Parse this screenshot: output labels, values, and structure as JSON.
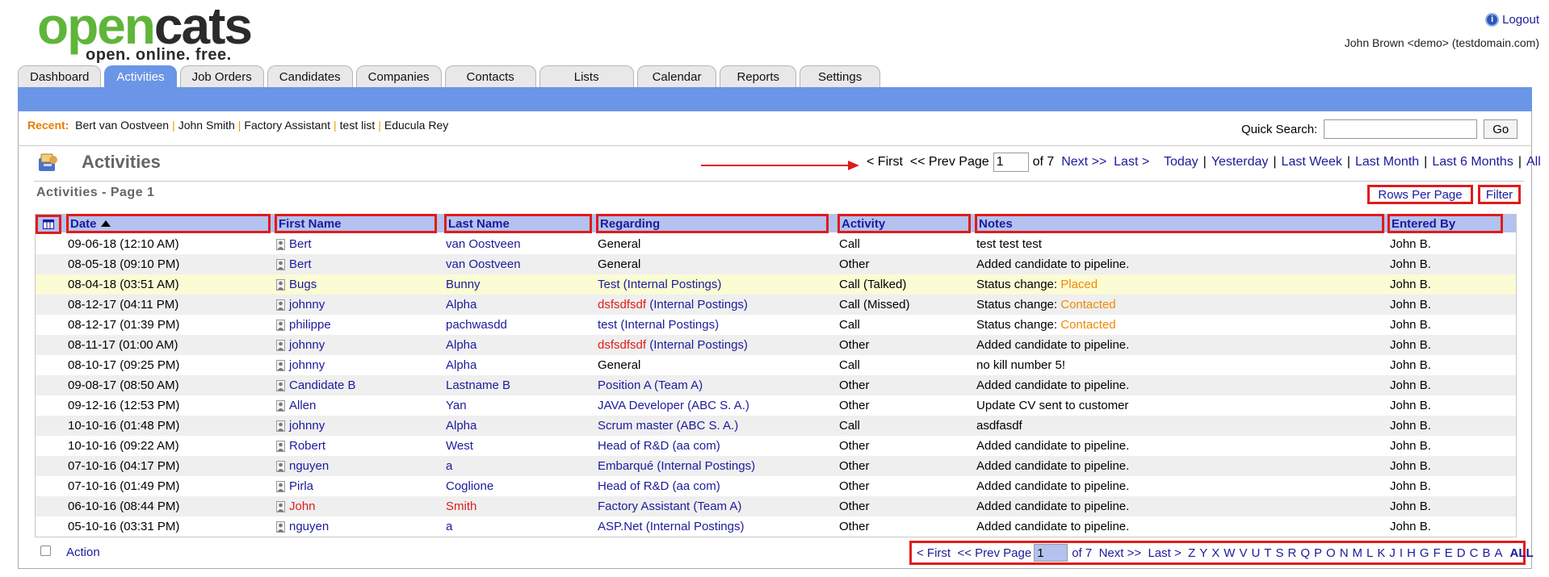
{
  "brand": {
    "word_green": "open",
    "word_dark": "cats",
    "tagline": "open. online. free."
  },
  "header": {
    "logout_label": "Logout",
    "user_line": "John Brown <demo> (testdomain.com)"
  },
  "tabs": [
    {
      "label": "Dashboard",
      "active": false
    },
    {
      "label": "Activities",
      "active": true
    },
    {
      "label": "Job Orders",
      "active": false
    },
    {
      "label": "Candidates",
      "active": false
    },
    {
      "label": "Companies",
      "active": false
    },
    {
      "label": "Contacts",
      "active": false
    },
    {
      "label": "Lists",
      "active": false
    },
    {
      "label": "Calendar",
      "active": false
    },
    {
      "label": "Reports",
      "active": false
    },
    {
      "label": "Settings",
      "active": false
    }
  ],
  "recent": {
    "label": "Recent:",
    "items": [
      "Bert van Oostveen",
      "John Smith",
      "Factory Assistant",
      "test list",
      "Educula Rey"
    ]
  },
  "quick_search": {
    "label": "Quick Search:",
    "value": "",
    "go_label": "Go"
  },
  "page": {
    "title": "Activities",
    "subtitle": "Activities - Page 1"
  },
  "top_pager": {
    "first": "< First",
    "prev": "<< Prev",
    "page_label": "Page",
    "page_value": "1",
    "of": "of 7",
    "next": "Next >>",
    "last": "Last >",
    "periods": [
      "Today",
      "Yesterday",
      "Last Week",
      "Last Month",
      "Last 6 Months",
      "All"
    ]
  },
  "controls": {
    "rows_per_page": "Rows Per Page",
    "filter": "Filter"
  },
  "columns": {
    "date": "Date",
    "first": "First Name",
    "last": "Last Name",
    "regarding": "Regarding",
    "activity": "Activity",
    "notes": "Notes",
    "by": "Entered By"
  },
  "rows": [
    {
      "date": "09-06-18 (12:10 AM)",
      "first": "Bert",
      "last": "van Oostveen",
      "reg_link": "",
      "reg_plain": "General",
      "reg_red": "",
      "activity": "Call",
      "notes": "test test test",
      "status": "",
      "by": "John B."
    },
    {
      "date": "08-05-18 (09:10 PM)",
      "first": "Bert",
      "last": "van Oostveen",
      "reg_link": "",
      "reg_plain": "General",
      "reg_red": "",
      "activity": "Other",
      "notes": "Added candidate to pipeline.",
      "status": "",
      "by": "John B."
    },
    {
      "date": "08-04-18 (03:51 AM)",
      "first": "Bugs",
      "last": "Bunny",
      "reg_link": "Test (Internal Postings)",
      "reg_plain": "",
      "reg_red": "",
      "activity": "Call (Talked)",
      "notes": "Status change: ",
      "status": "Placed",
      "by": "John B."
    },
    {
      "date": "08-12-17 (04:11 PM)",
      "first": "johnny",
      "last": "Alpha",
      "reg_link": " (Internal Postings)",
      "reg_plain": "",
      "reg_red": "dsfsdfsdf",
      "activity": "Call (Missed)",
      "notes": "Status change: ",
      "status": "Contacted",
      "by": "John B."
    },
    {
      "date": "08-12-17 (01:39 PM)",
      "first": "philippe",
      "last": "pachwasdd",
      "reg_link": "test (Internal Postings)",
      "reg_plain": "",
      "reg_red": "",
      "activity": "Call",
      "notes": "Status change: ",
      "status": "Contacted",
      "by": "John B."
    },
    {
      "date": "08-11-17 (01:00 AM)",
      "first": "johnny",
      "last": "Alpha",
      "reg_link": " (Internal Postings)",
      "reg_plain": "",
      "reg_red": "dsfsdfsdf",
      "activity": "Other",
      "notes": "Added candidate to pipeline.",
      "status": "",
      "by": "John B."
    },
    {
      "date": "08-10-17 (09:25 PM)",
      "first": "johnny",
      "last": "Alpha",
      "reg_link": "",
      "reg_plain": "General",
      "reg_red": "",
      "activity": "Call",
      "notes": "no kill number 5!",
      "status": "",
      "by": "John B."
    },
    {
      "date": "09-08-17 (08:50 AM)",
      "first": "Candidate B",
      "last": "Lastname B",
      "reg_link": "Position A (Team A)",
      "reg_plain": "",
      "reg_red": "",
      "activity": "Other",
      "notes": "Added candidate to pipeline.",
      "status": "",
      "by": "John B."
    },
    {
      "date": "09-12-16 (12:53 PM)",
      "first": "Allen",
      "last": "Yan",
      "reg_link": "JAVA Developer (ABC S. A.)",
      "reg_plain": "",
      "reg_red": "",
      "activity": "Other",
      "notes": "Update CV sent to customer",
      "status": "",
      "by": "John B."
    },
    {
      "date": "10-10-16 (01:48 PM)",
      "first": "johnny",
      "last": "Alpha",
      "reg_link": "Scrum master (ABC S. A.)",
      "reg_plain": "",
      "reg_red": "",
      "activity": "Call",
      "notes": "asdfasdf",
      "status": "",
      "by": "John B."
    },
    {
      "date": "10-10-16 (09:22 AM)",
      "first": "Robert",
      "last": "West",
      "reg_link": "Head of R&D (aa com)",
      "reg_plain": "",
      "reg_red": "",
      "activity": "Other",
      "notes": "Added candidate to pipeline.",
      "status": "",
      "by": "John B."
    },
    {
      "date": "07-10-16 (04:17 PM)",
      "first": "nguyen",
      "last": "a",
      "reg_link": "Embarqué (Internal Postings)",
      "reg_plain": "",
      "reg_red": "",
      "activity": "Other",
      "notes": "Added candidate to pipeline.",
      "status": "",
      "by": "John B."
    },
    {
      "date": "07-10-16 (01:49 PM)",
      "first": "Pirla",
      "last": "Coglione",
      "reg_link": "Head of R&D (aa com)",
      "reg_plain": "",
      "reg_red": "",
      "activity": "Other",
      "notes": "Added candidate to pipeline.",
      "status": "",
      "by": "John B."
    },
    {
      "date": "06-10-16 (08:44 PM)",
      "first": "John",
      "last": "Smith",
      "reg_link": "Factory Assistant (Team A)",
      "reg_plain": "",
      "reg_red": "",
      "activity": "Other",
      "notes": "Added candidate to pipeline.",
      "status": "",
      "by": "John B.",
      "name_red": true
    },
    {
      "date": "05-10-16 (03:31 PM)",
      "first": "nguyen",
      "last": "a",
      "reg_link": "ASP.Net (Internal Postings)",
      "reg_plain": "",
      "reg_red": "",
      "activity": "Other",
      "notes": "Added candidate to pipeline.",
      "status": "",
      "by": "John B."
    }
  ],
  "footer": {
    "action_label": "Action",
    "first": "< First",
    "prev": "<< Prev",
    "page_label": "Page",
    "page_value": "1",
    "of": "of 7",
    "next": "Next >>",
    "last": "Last >",
    "letters": [
      "Z",
      "Y",
      "X",
      "W",
      "V",
      "U",
      "T",
      "S",
      "R",
      "Q",
      "P",
      "O",
      "N",
      "M",
      "L",
      "K",
      "J",
      "I",
      "H",
      "G",
      "F",
      "E",
      "D",
      "C",
      "B",
      "A"
    ],
    "all_label": "ALL"
  },
  "colors": {
    "tab_blue": "#6b95e6",
    "header_blue": "#b3c2ee",
    "link": "#1b1b9c",
    "annotation_red": "#e01b1b",
    "highlight_row": "#fbfbd4",
    "status_orange": "#f08a00"
  }
}
